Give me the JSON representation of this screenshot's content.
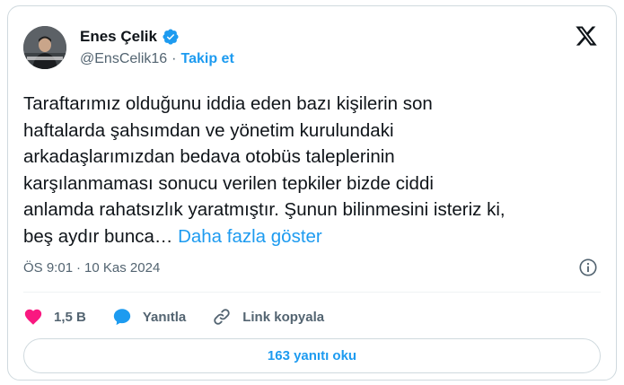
{
  "author": {
    "name": "Enes Çelik",
    "handle": "@EnsCelik16",
    "separator": "·",
    "follow_label": "Takip et"
  },
  "tweet": {
    "text": "Taraftarımız olduğunu iddia eden bazı kişilerin son\nhaftalarda şahsımdan ve yönetim kurulundaki\narkadaşlarımızdan bedava otobüs taleplerinin\nkarşılanmaması sonucu verilen tepkiler bizde ciddi\nanlamda rahatsızlık yaratmıştır. Şunun bilinmesini isteriz ki,\nbeş aydır bunca… ",
    "show_more": "Daha fazla göster",
    "time": "ÖS 9:01",
    "separator": "·",
    "date": "10 Kas 2024"
  },
  "actions": {
    "likes": "1,5 B",
    "reply_label": "Yanıtla",
    "copy_link_label": "Link kopyala"
  },
  "read_replies_label": "163 yanıtı oku",
  "icons": {
    "verified": "verified-badge-icon",
    "x_logo": "x-logo-icon",
    "info": "info-icon",
    "like": "heart-icon",
    "reply": "reply-bubble-icon",
    "link": "link-icon"
  },
  "colors": {
    "accent": "#1d9bf0",
    "like": "#f91880",
    "muted": "#536471",
    "text": "#0f1419",
    "border": "#cfd9de"
  }
}
